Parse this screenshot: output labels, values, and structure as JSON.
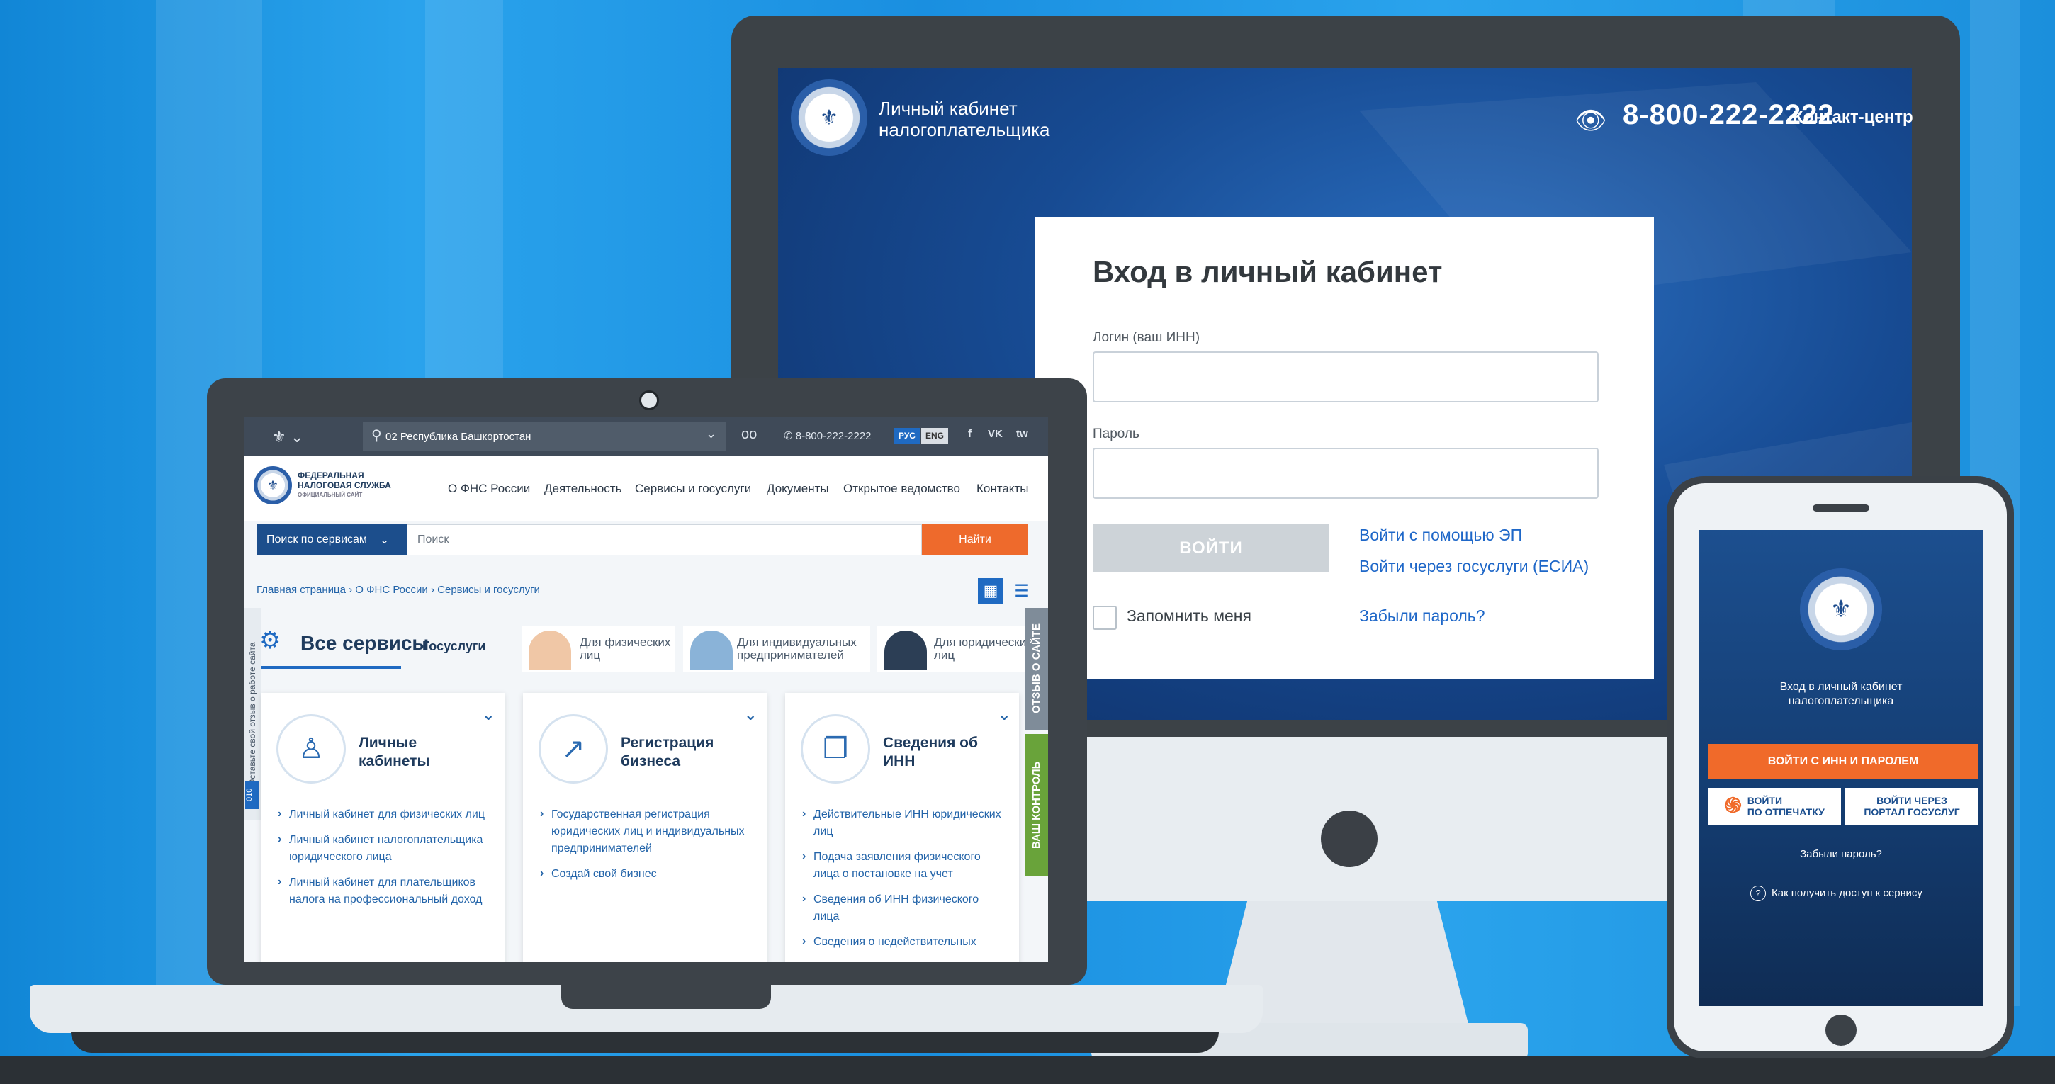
{
  "monitor": {
    "header_title_line1": "Личный кабинет",
    "header_title_line2": "налогоплательщика",
    "phone": "8-800-222-2222",
    "contact_center": "Контакт-центр",
    "login": {
      "title": "Вход в личный кабинет",
      "login_label": "Логин (ваш ИНН)",
      "login_value": "",
      "password_label": "Пароль",
      "password_value": "",
      "submit": "ВОЙТИ",
      "link_ep": "Войти с помощью ЭП",
      "link_gosuslugi": "Войти через госуслуги (ЕСИА)",
      "remember": "Запомнить меня",
      "forgot": "Забыли пароль?"
    }
  },
  "laptop": {
    "topbar": {
      "region": "02 Республика Башкортостан",
      "phone": "8-800-222-2222",
      "lang_ru": "РУС",
      "lang_en": "ENG",
      "social": [
        "f",
        "VK",
        "tw"
      ]
    },
    "logo": {
      "line1": "ФЕДЕРАЛЬНАЯ",
      "line2": "НАЛОГОВАЯ СЛУЖБА",
      "line3": "ОФИЦИАЛЬНЫЙ САЙТ"
    },
    "nav": [
      "О ФНС России",
      "Деятельность",
      "Сервисы и госуслуги",
      "Документы",
      "Открытое ведомство",
      "Контакты"
    ],
    "search": {
      "scope": "Поиск по сервисам",
      "placeholder": "Поиск",
      "button": "Найти"
    },
    "breadcrumb": [
      "Главная страница",
      "О ФНС России",
      "Сервисы и госуслуги"
    ],
    "services_title": "Все сервисы",
    "gosuslugi_tab": "Госуслуги",
    "categories": [
      {
        "line1": "Для физических",
        "line2": "лиц"
      },
      {
        "line1": "Для индивидуальных",
        "line2": "предпринимателей"
      },
      {
        "line1": "Для юридических",
        "line2": "лиц"
      }
    ],
    "side_feedback": "Оставьте свой отзыв о работе сайта",
    "side_feedback_num": "010",
    "side_otzyv": "ОТЗЫВ О САЙТЕ",
    "side_control": "ВАШ КОНТРОЛЬ",
    "cards": [
      {
        "title_line1": "Личные",
        "title_line2": "кабинеты",
        "items": [
          "Личный кабинет для физических лиц",
          "Личный кабинет налогоплательщика юридического лица",
          "Личный кабинет для плательщиков налога на профессиональный доход"
        ]
      },
      {
        "title_line1": "Регистрация",
        "title_line2": "бизнеса",
        "items": [
          "Государственная регистрация юридических лиц и индивидуальных предпринимателей",
          "Создай свой бизнес"
        ]
      },
      {
        "title_line1": "Сведения об",
        "title_line2": "ИНН",
        "items": [
          "Действительные ИНН юридических лиц",
          "Подача заявления физического лица о постановке на учет",
          "Сведения об ИНН физического лица",
          "Сведения о недействительных"
        ]
      }
    ]
  },
  "phone": {
    "caption_line1": "Вход в личный кабинет",
    "caption_line2": "налогоплательщика",
    "btn_inn": "ВОЙТИ С ИНН И ПАРОЛЕМ",
    "btn_finger_line1": "ВОЙТИ",
    "btn_finger_line2": "ПО ОТПЕЧАТКУ",
    "btn_portal_line1": "ВОЙТИ ЧЕРЕЗ",
    "btn_portal_line2": "ПОРТАЛ ГОСУСЛУГ",
    "forgot": "Забыли пароль?",
    "help": "Как получить доступ к сервису"
  },
  "colors": {
    "background": "#1a8fe0",
    "accent_orange": "#ee6a2c",
    "brand_blue": "#1c4e8c",
    "link_blue": "#1e67c8"
  }
}
